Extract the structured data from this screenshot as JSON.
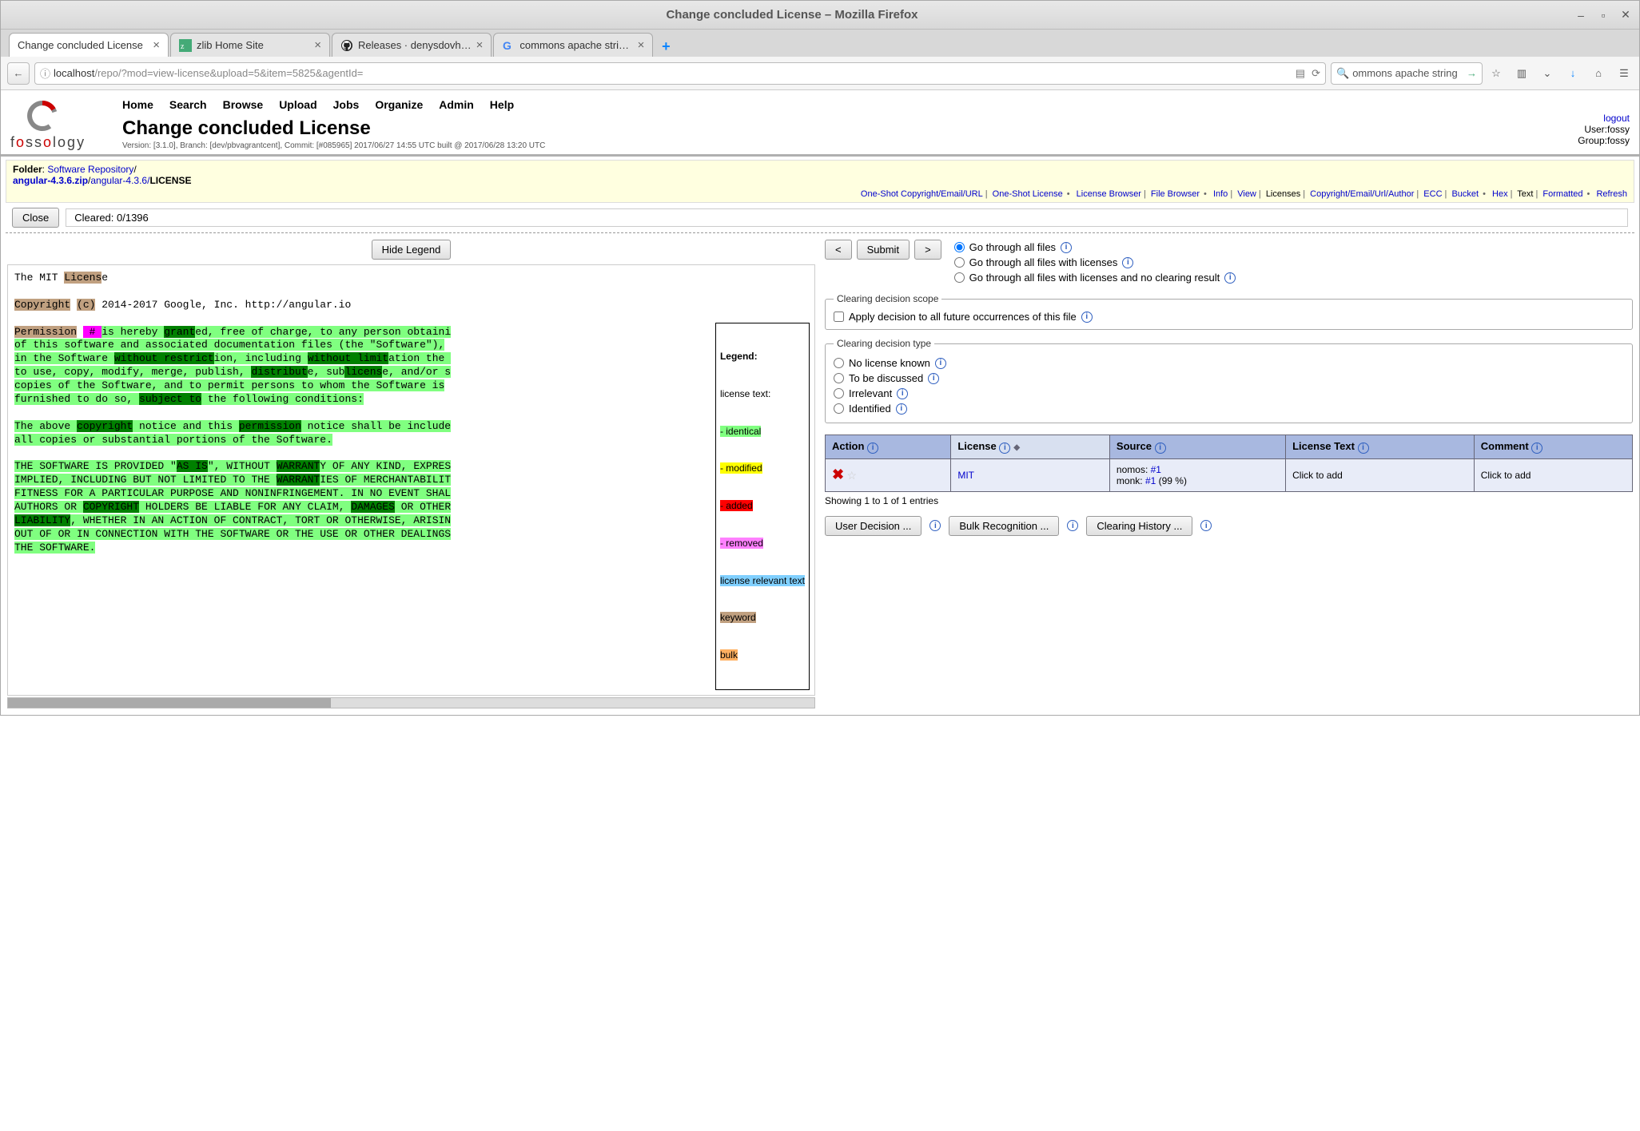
{
  "window": {
    "title": "Change concluded License – Mozilla Firefox"
  },
  "tabs": [
    {
      "label": "Change concluded License",
      "active": true
    },
    {
      "label": "zlib Home Site",
      "active": false
    },
    {
      "label": "Releases · denysdovh…",
      "active": false
    },
    {
      "label": "commons apache stri…",
      "active": false
    }
  ],
  "url": {
    "host": "localhost",
    "path": "/repo/?mod=view-license&upload=5&item=5825&agentId="
  },
  "search": {
    "value": "ommons apache string"
  },
  "menu": [
    "Home",
    "Search",
    "Browse",
    "Upload",
    "Jobs",
    "Organize",
    "Admin",
    "Help"
  ],
  "page": {
    "title": "Change concluded License",
    "version": "Version: [3.1.0], Branch: [dev/pbvagrantcent], Commit: [#085965] 2017/06/27 14:55 UTC built @ 2017/06/28 13:20 UTC"
  },
  "userinfo": {
    "logout": "logout",
    "user_label": "User:",
    "user": "fossy",
    "group_label": "Group:",
    "group": "fossy"
  },
  "breadcrumb": {
    "folder_label": "Folder",
    "folder_link": "Software Repository",
    "path1": "angular-4.3.6.zip",
    "path2": "angular-4.3.6/",
    "file": "LICENSE"
  },
  "submenu": {
    "oneshot_cu": "One-Shot Copyright/Email/URL",
    "oneshot_lic": "One-Shot License",
    "lic_browser": "License Browser",
    "file_browser": "File Browser",
    "info": "Info",
    "view": "View",
    "licenses": "Licenses",
    "copyright": "Copyright/Email/Url/Author",
    "ecc": "ECC",
    "bucket": "Bucket",
    "hex": "Hex",
    "text": "Text",
    "formatted": "Formatted",
    "refresh": "Refresh"
  },
  "close": {
    "button": "Close",
    "cleared": "Cleared: 0/1396"
  },
  "hide_legend": "Hide Legend",
  "nav": {
    "prev": "<",
    "submit": "Submit",
    "next": ">"
  },
  "radios": {
    "all": "Go through all files",
    "with_lic": "Go through all files with licenses",
    "no_clear": "Go through all files with licenses and no clearing result"
  },
  "scope": {
    "legend": "Clearing decision scope",
    "apply": "Apply decision to all future occurrences of this file"
  },
  "decision_type": {
    "legend": "Clearing decision type",
    "no_license": "No license known",
    "tbd": "To be discussed",
    "irrelevant": "Irrelevant",
    "identified": "Identified"
  },
  "table": {
    "headers": {
      "action": "Action",
      "license": "License",
      "source": "Source",
      "text": "License Text",
      "comment": "Comment"
    },
    "row": {
      "license": "MIT",
      "source_nomos_label": "nomos: ",
      "source_nomos_num": "#1",
      "source_monk_label": "monk: ",
      "source_monk_num": "#1",
      "source_monk_pct": " (99 %)",
      "text": "Click to add",
      "comment": "Click to add"
    },
    "showing": "Showing 1 to 1 of 1 entries"
  },
  "actions": {
    "user_decision": "User Decision ...",
    "bulk": "Bulk Recognition ...",
    "history": "Clearing History ..."
  },
  "legend": {
    "title": "Legend:",
    "license_text": "license text:",
    "identical": "- identical",
    "modified": "- modified",
    "added": "- added",
    "removed": "- removed",
    "lrt": "license relevant text",
    "keyword": "keyword",
    "bulk": "bulk"
  }
}
